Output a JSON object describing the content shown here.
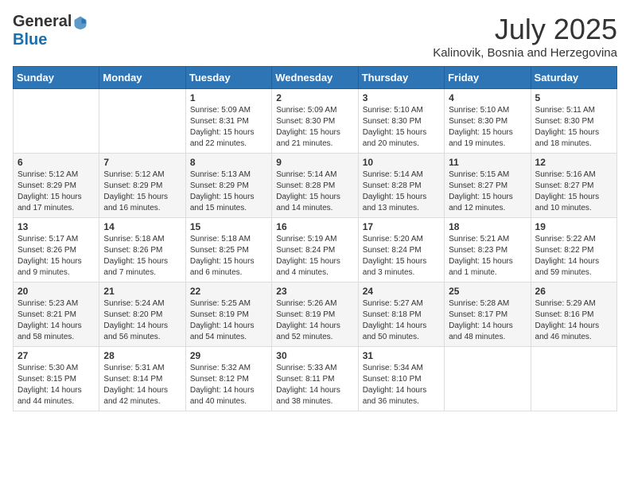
{
  "header": {
    "logo_general": "General",
    "logo_blue": "Blue",
    "month": "July 2025",
    "location": "Kalinovik, Bosnia and Herzegovina"
  },
  "days_of_week": [
    "Sunday",
    "Monday",
    "Tuesday",
    "Wednesday",
    "Thursday",
    "Friday",
    "Saturday"
  ],
  "weeks": [
    [
      {
        "day": "",
        "info": ""
      },
      {
        "day": "",
        "info": ""
      },
      {
        "day": "1",
        "sunrise": "Sunrise: 5:09 AM",
        "sunset": "Sunset: 8:31 PM",
        "daylight": "Daylight: 15 hours and 22 minutes."
      },
      {
        "day": "2",
        "sunrise": "Sunrise: 5:09 AM",
        "sunset": "Sunset: 8:30 PM",
        "daylight": "Daylight: 15 hours and 21 minutes."
      },
      {
        "day": "3",
        "sunrise": "Sunrise: 5:10 AM",
        "sunset": "Sunset: 8:30 PM",
        "daylight": "Daylight: 15 hours and 20 minutes."
      },
      {
        "day": "4",
        "sunrise": "Sunrise: 5:10 AM",
        "sunset": "Sunset: 8:30 PM",
        "daylight": "Daylight: 15 hours and 19 minutes."
      },
      {
        "day": "5",
        "sunrise": "Sunrise: 5:11 AM",
        "sunset": "Sunset: 8:30 PM",
        "daylight": "Daylight: 15 hours and 18 minutes."
      }
    ],
    [
      {
        "day": "6",
        "sunrise": "Sunrise: 5:12 AM",
        "sunset": "Sunset: 8:29 PM",
        "daylight": "Daylight: 15 hours and 17 minutes."
      },
      {
        "day": "7",
        "sunrise": "Sunrise: 5:12 AM",
        "sunset": "Sunset: 8:29 PM",
        "daylight": "Daylight: 15 hours and 16 minutes."
      },
      {
        "day": "8",
        "sunrise": "Sunrise: 5:13 AM",
        "sunset": "Sunset: 8:29 PM",
        "daylight": "Daylight: 15 hours and 15 minutes."
      },
      {
        "day": "9",
        "sunrise": "Sunrise: 5:14 AM",
        "sunset": "Sunset: 8:28 PM",
        "daylight": "Daylight: 15 hours and 14 minutes."
      },
      {
        "day": "10",
        "sunrise": "Sunrise: 5:14 AM",
        "sunset": "Sunset: 8:28 PM",
        "daylight": "Daylight: 15 hours and 13 minutes."
      },
      {
        "day": "11",
        "sunrise": "Sunrise: 5:15 AM",
        "sunset": "Sunset: 8:27 PM",
        "daylight": "Daylight: 15 hours and 12 minutes."
      },
      {
        "day": "12",
        "sunrise": "Sunrise: 5:16 AM",
        "sunset": "Sunset: 8:27 PM",
        "daylight": "Daylight: 15 hours and 10 minutes."
      }
    ],
    [
      {
        "day": "13",
        "sunrise": "Sunrise: 5:17 AM",
        "sunset": "Sunset: 8:26 PM",
        "daylight": "Daylight: 15 hours and 9 minutes."
      },
      {
        "day": "14",
        "sunrise": "Sunrise: 5:18 AM",
        "sunset": "Sunset: 8:26 PM",
        "daylight": "Daylight: 15 hours and 7 minutes."
      },
      {
        "day": "15",
        "sunrise": "Sunrise: 5:18 AM",
        "sunset": "Sunset: 8:25 PM",
        "daylight": "Daylight: 15 hours and 6 minutes."
      },
      {
        "day": "16",
        "sunrise": "Sunrise: 5:19 AM",
        "sunset": "Sunset: 8:24 PM",
        "daylight": "Daylight: 15 hours and 4 minutes."
      },
      {
        "day": "17",
        "sunrise": "Sunrise: 5:20 AM",
        "sunset": "Sunset: 8:24 PM",
        "daylight": "Daylight: 15 hours and 3 minutes."
      },
      {
        "day": "18",
        "sunrise": "Sunrise: 5:21 AM",
        "sunset": "Sunset: 8:23 PM",
        "daylight": "Daylight: 15 hours and 1 minute."
      },
      {
        "day": "19",
        "sunrise": "Sunrise: 5:22 AM",
        "sunset": "Sunset: 8:22 PM",
        "daylight": "Daylight: 14 hours and 59 minutes."
      }
    ],
    [
      {
        "day": "20",
        "sunrise": "Sunrise: 5:23 AM",
        "sunset": "Sunset: 8:21 PM",
        "daylight": "Daylight: 14 hours and 58 minutes."
      },
      {
        "day": "21",
        "sunrise": "Sunrise: 5:24 AM",
        "sunset": "Sunset: 8:20 PM",
        "daylight": "Daylight: 14 hours and 56 minutes."
      },
      {
        "day": "22",
        "sunrise": "Sunrise: 5:25 AM",
        "sunset": "Sunset: 8:19 PM",
        "daylight": "Daylight: 14 hours and 54 minutes."
      },
      {
        "day": "23",
        "sunrise": "Sunrise: 5:26 AM",
        "sunset": "Sunset: 8:19 PM",
        "daylight": "Daylight: 14 hours and 52 minutes."
      },
      {
        "day": "24",
        "sunrise": "Sunrise: 5:27 AM",
        "sunset": "Sunset: 8:18 PM",
        "daylight": "Daylight: 14 hours and 50 minutes."
      },
      {
        "day": "25",
        "sunrise": "Sunrise: 5:28 AM",
        "sunset": "Sunset: 8:17 PM",
        "daylight": "Daylight: 14 hours and 48 minutes."
      },
      {
        "day": "26",
        "sunrise": "Sunrise: 5:29 AM",
        "sunset": "Sunset: 8:16 PM",
        "daylight": "Daylight: 14 hours and 46 minutes."
      }
    ],
    [
      {
        "day": "27",
        "sunrise": "Sunrise: 5:30 AM",
        "sunset": "Sunset: 8:15 PM",
        "daylight": "Daylight: 14 hours and 44 minutes."
      },
      {
        "day": "28",
        "sunrise": "Sunrise: 5:31 AM",
        "sunset": "Sunset: 8:14 PM",
        "daylight": "Daylight: 14 hours and 42 minutes."
      },
      {
        "day": "29",
        "sunrise": "Sunrise: 5:32 AM",
        "sunset": "Sunset: 8:12 PM",
        "daylight": "Daylight: 14 hours and 40 minutes."
      },
      {
        "day": "30",
        "sunrise": "Sunrise: 5:33 AM",
        "sunset": "Sunset: 8:11 PM",
        "daylight": "Daylight: 14 hours and 38 minutes."
      },
      {
        "day": "31",
        "sunrise": "Sunrise: 5:34 AM",
        "sunset": "Sunset: 8:10 PM",
        "daylight": "Daylight: 14 hours and 36 minutes."
      },
      {
        "day": "",
        "info": ""
      },
      {
        "day": "",
        "info": ""
      }
    ]
  ]
}
